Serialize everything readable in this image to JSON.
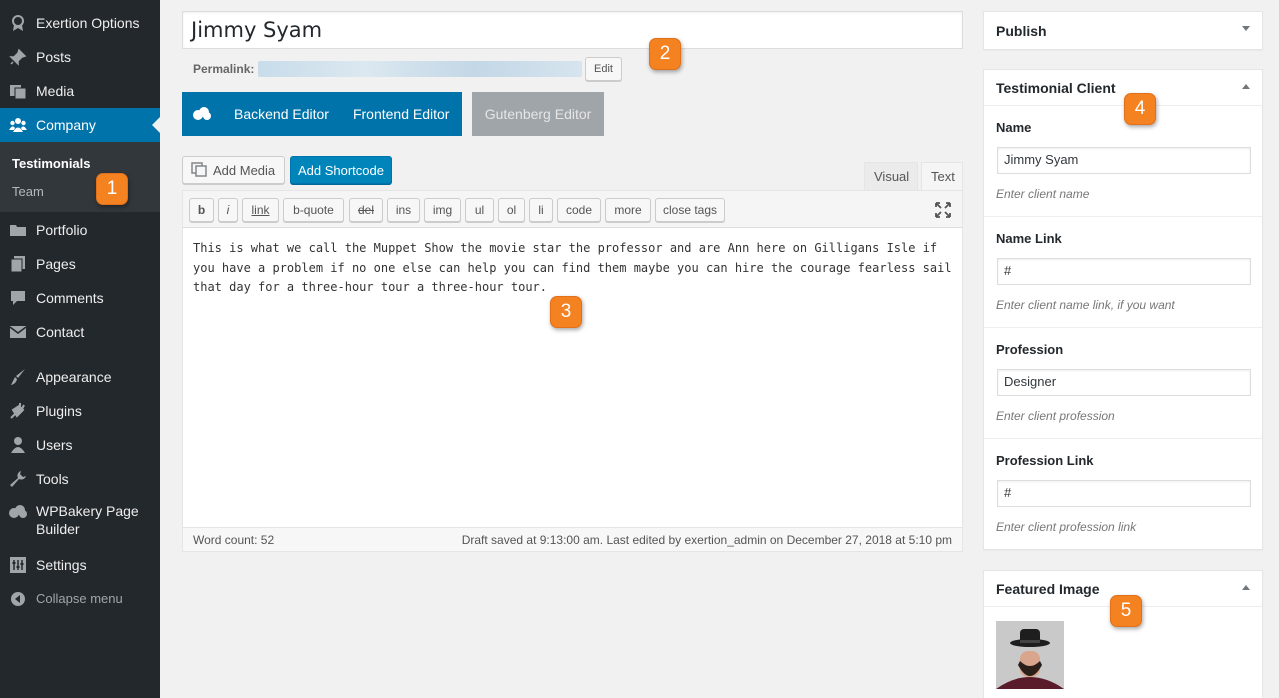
{
  "sidebar": {
    "items": [
      {
        "label": "Exertion Options",
        "icon": "award-icon"
      },
      {
        "label": "Posts",
        "icon": "pin-icon"
      },
      {
        "label": "Media",
        "icon": "media-icon"
      },
      {
        "label": "Company",
        "icon": "groups-icon"
      },
      {
        "label": "Portfolio",
        "icon": "folder-icon"
      },
      {
        "label": "Pages",
        "icon": "pages-icon"
      },
      {
        "label": "Comments",
        "icon": "comment-icon"
      },
      {
        "label": "Contact",
        "icon": "email-icon"
      },
      {
        "label": "Appearance",
        "icon": "brush-icon"
      },
      {
        "label": "Plugins",
        "icon": "plugin-icon"
      },
      {
        "label": "Users",
        "icon": "user-icon"
      },
      {
        "label": "Tools",
        "icon": "wrench-icon"
      },
      {
        "label": "WPBakery Page Builder",
        "icon": "cloud-icon"
      },
      {
        "label": "Settings",
        "icon": "settings-icon"
      }
    ],
    "submenu": [
      "Testimonials",
      "Team"
    ],
    "collapse_label": "Collapse menu",
    "active_color": "#0073aa"
  },
  "badges": [
    "1",
    "2",
    "3",
    "4",
    "5"
  ],
  "post": {
    "title": "Jimmy Syam",
    "permalink_label": "Permalink:",
    "edit_label": "Edit"
  },
  "editor_switch": {
    "backend": "Backend Editor",
    "frontend": "Frontend Editor",
    "gutenberg": "Gutenberg Editor"
  },
  "toolbar": {
    "add_media": "Add Media",
    "add_shortcode": "Add Shortcode",
    "tab_visual": "Visual",
    "tab_text": "Text",
    "quicktags": [
      "b",
      "i",
      "link",
      "b-quote",
      "del",
      "ins",
      "img",
      "ul",
      "ol",
      "li",
      "code",
      "more",
      "close tags"
    ]
  },
  "content": "This is what we call the Muppet Show the movie star the professor and are Ann here on Gilligans Isle if you have a problem if no one else can help you can find them maybe you can hire the courage fearless sail that day for a three-hour tour a three-hour tour.",
  "status": {
    "word_count": "Word count: 52",
    "draft": "Draft saved at 9:13:00 am. Last edited by exertion_admin on December 27, 2018 at 5:10 pm"
  },
  "publish": {
    "title": "Publish"
  },
  "testimonial_client": {
    "title": "Testimonial Client",
    "fields": [
      {
        "label": "Name",
        "value": "Jimmy Syam",
        "description": "Enter client name"
      },
      {
        "label": "Name Link",
        "value": "#",
        "description": "Enter client name link, if you want"
      },
      {
        "label": "Profession",
        "value": "Designer",
        "description": "Enter client profession"
      },
      {
        "label": "Profession Link",
        "value": "#",
        "description": "Enter client profession link"
      }
    ]
  },
  "featured_image": {
    "title": "Featured Image"
  }
}
